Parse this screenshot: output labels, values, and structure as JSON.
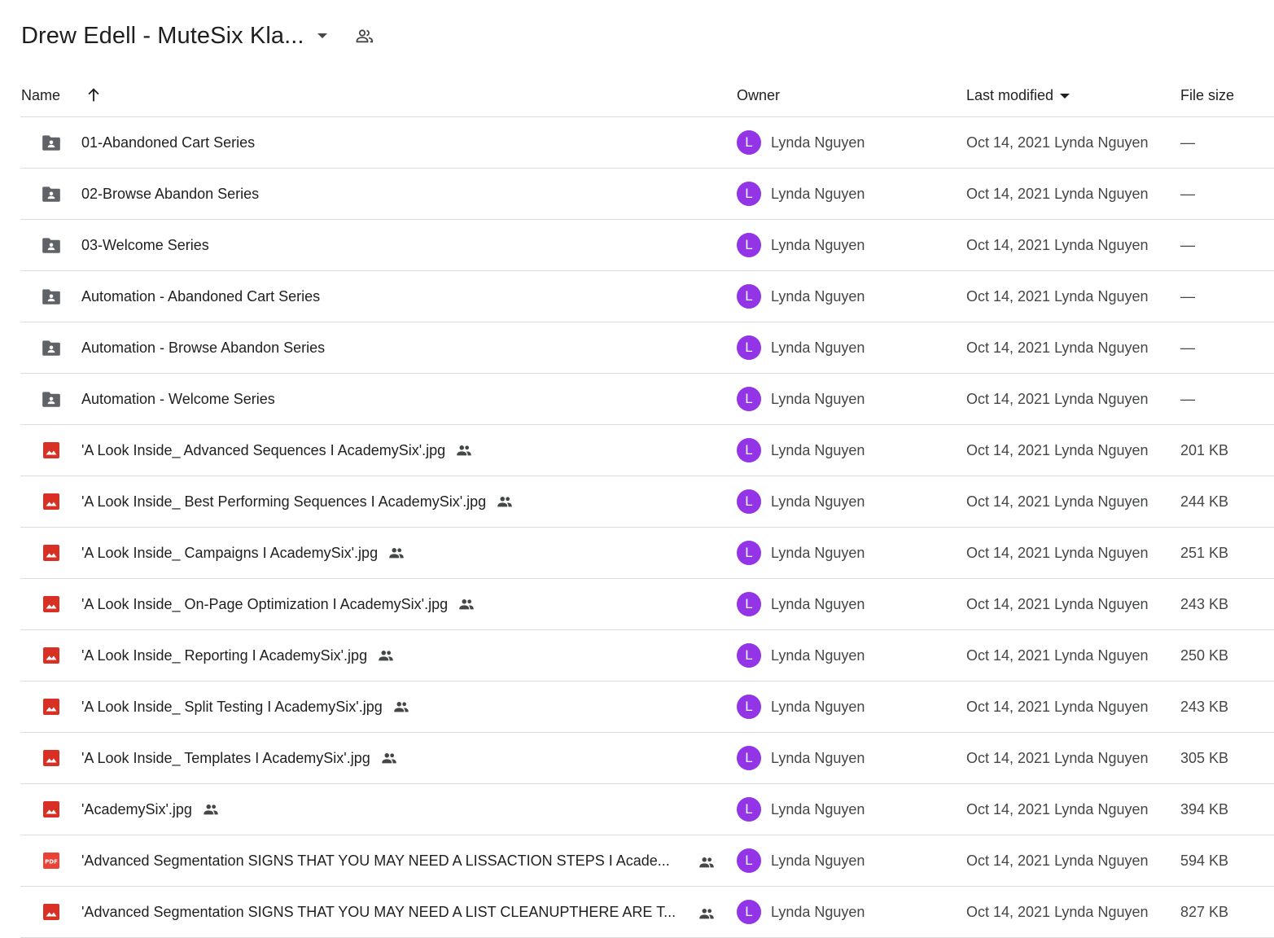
{
  "header": {
    "title": "Drew Edell - MuteSix Kla...",
    "dropdown_icon": "caret-down-icon",
    "share_icon": "people-outline-icon"
  },
  "columns": {
    "name": "Name",
    "sort_icon": "arrow-up-icon",
    "owner": "Owner",
    "last_modified": "Last modified",
    "file_size": "File size"
  },
  "colors": {
    "avatar": "#9334e6",
    "folder_icon": "#5f6368",
    "image_icon": "#d93025",
    "pdf_icon": "#ea4335",
    "divider": "#dadce0"
  },
  "files": [
    {
      "type": "folder",
      "icon": "shared-folder-icon",
      "name": "01-Abandoned Cart Series",
      "shared": false,
      "owner": "Lynda Nguyen",
      "avatar_letter": "L",
      "modified": "Oct 14, 2021 Lynda Nguyen",
      "size": "—"
    },
    {
      "type": "folder",
      "icon": "shared-folder-icon",
      "name": "02-Browse Abandon Series",
      "shared": false,
      "owner": "Lynda Nguyen",
      "avatar_letter": "L",
      "modified": "Oct 14, 2021 Lynda Nguyen",
      "size": "—"
    },
    {
      "type": "folder",
      "icon": "shared-folder-icon",
      "name": "03-Welcome Series",
      "shared": false,
      "owner": "Lynda Nguyen",
      "avatar_letter": "L",
      "modified": "Oct 14, 2021 Lynda Nguyen",
      "size": "—"
    },
    {
      "type": "folder",
      "icon": "shared-folder-icon",
      "name": "Automation - Abandoned Cart Series",
      "shared": false,
      "owner": "Lynda Nguyen",
      "avatar_letter": "L",
      "modified": "Oct 14, 2021 Lynda Nguyen",
      "size": "—"
    },
    {
      "type": "folder",
      "icon": "shared-folder-icon",
      "name": "Automation - Browse Abandon Series",
      "shared": false,
      "owner": "Lynda Nguyen",
      "avatar_letter": "L",
      "modified": "Oct 14, 2021 Lynda Nguyen",
      "size": "—"
    },
    {
      "type": "folder",
      "icon": "shared-folder-icon",
      "name": "Automation - Welcome Series",
      "shared": false,
      "owner": "Lynda Nguyen",
      "avatar_letter": "L",
      "modified": "Oct 14, 2021 Lynda Nguyen",
      "size": "—"
    },
    {
      "type": "image",
      "icon": "image-file-icon",
      "name": "'A Look Inside_ Advanced Sequences I AcademySix'.jpg",
      "shared": true,
      "owner": "Lynda Nguyen",
      "avatar_letter": "L",
      "modified": "Oct 14, 2021 Lynda Nguyen",
      "size": "201 KB"
    },
    {
      "type": "image",
      "icon": "image-file-icon",
      "name": "'A Look Inside_ Best Performing Sequences I AcademySix'.jpg",
      "shared": true,
      "owner": "Lynda Nguyen",
      "avatar_letter": "L",
      "modified": "Oct 14, 2021 Lynda Nguyen",
      "size": "244 KB"
    },
    {
      "type": "image",
      "icon": "image-file-icon",
      "name": "'A Look Inside_ Campaigns I AcademySix'.jpg",
      "shared": true,
      "owner": "Lynda Nguyen",
      "avatar_letter": "L",
      "modified": "Oct 14, 2021 Lynda Nguyen",
      "size": "251 KB"
    },
    {
      "type": "image",
      "icon": "image-file-icon",
      "name": "'A Look Inside_ On-Page Optimization I AcademySix'.jpg",
      "shared": true,
      "owner": "Lynda Nguyen",
      "avatar_letter": "L",
      "modified": "Oct 14, 2021 Lynda Nguyen",
      "size": "243 KB"
    },
    {
      "type": "image",
      "icon": "image-file-icon",
      "name": "'A Look Inside_ Reporting I AcademySix'.jpg",
      "shared": true,
      "owner": "Lynda Nguyen",
      "avatar_letter": "L",
      "modified": "Oct 14, 2021 Lynda Nguyen",
      "size": "250 KB"
    },
    {
      "type": "image",
      "icon": "image-file-icon",
      "name": "'A Look Inside_ Split Testing I AcademySix'.jpg",
      "shared": true,
      "owner": "Lynda Nguyen",
      "avatar_letter": "L",
      "modified": "Oct 14, 2021 Lynda Nguyen",
      "size": "243 KB"
    },
    {
      "type": "image",
      "icon": "image-file-icon",
      "name": "'A Look Inside_ Templates I AcademySix'.jpg",
      "shared": true,
      "owner": "Lynda Nguyen",
      "avatar_letter": "L",
      "modified": "Oct 14, 2021 Lynda Nguyen",
      "size": "305 KB"
    },
    {
      "type": "image",
      "icon": "image-file-icon",
      "name": "'AcademySix'.jpg",
      "shared": true,
      "owner": "Lynda Nguyen",
      "avatar_letter": "L",
      "modified": "Oct 14, 2021 Lynda Nguyen",
      "size": "394 KB"
    },
    {
      "type": "pdf",
      "icon": "pdf-file-icon",
      "name": "'Advanced Segmentation SIGNS THAT YOU MAY NEED A LISSACTION STEPS I Acade...",
      "shared": true,
      "owner": "Lynda Nguyen",
      "avatar_letter": "L",
      "modified": "Oct 14, 2021 Lynda Nguyen",
      "size": "594 KB"
    },
    {
      "type": "image",
      "icon": "image-file-icon",
      "name": "'Advanced Segmentation SIGNS THAT YOU MAY NEED A LIST CLEANUPTHERE ARE T...",
      "shared": true,
      "owner": "Lynda Nguyen",
      "avatar_letter": "L",
      "modified": "Oct 14, 2021 Lynda Nguyen",
      "size": "827 KB"
    }
  ]
}
